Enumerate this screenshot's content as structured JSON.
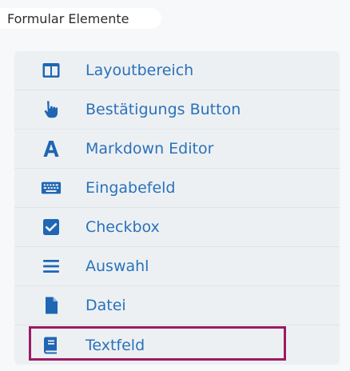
{
  "section": {
    "title": "Formular Elemente"
  },
  "items": [
    {
      "label": "Layoutbereich",
      "icon": "layout-columns-icon"
    },
    {
      "label": "Bestätigungs Button",
      "icon": "pointing-hand-icon"
    },
    {
      "label": "Markdown Editor",
      "icon": "letter-a-icon"
    },
    {
      "label": "Eingabefeld",
      "icon": "keyboard-icon"
    },
    {
      "label": "Checkbox",
      "icon": "checkbox-checked-icon"
    },
    {
      "label": "Auswahl",
      "icon": "list-lines-icon"
    },
    {
      "label": "Datei",
      "icon": "file-icon"
    },
    {
      "label": "Textfeld",
      "icon": "book-icon"
    }
  ],
  "colors": {
    "icon": "#1f66b3",
    "label": "#2a72bb",
    "highlight_border": "#9c1a63",
    "list_background": "#edf0f3"
  },
  "highlighted_item": "Textfeld"
}
